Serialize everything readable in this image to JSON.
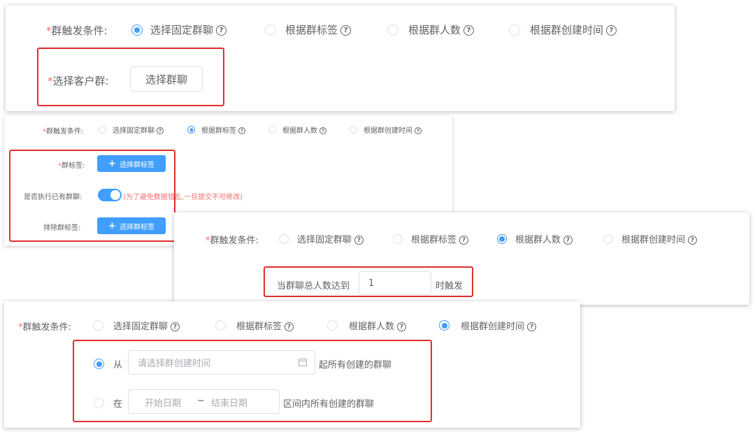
{
  "trigger_label": "群触发条件:",
  "required_mark": "*",
  "help_glyph": "?",
  "options": {
    "fixed": "选择固定群聊",
    "by_tag": "根据群标签",
    "by_count": "根据群人数",
    "by_time": "根据群创建时间"
  },
  "panel1": {
    "selected": "fixed",
    "customer_group_label": "选择客户群:",
    "select_group_button": "选择群聊"
  },
  "panel2": {
    "selected": "by_tag",
    "group_tag_label": "群标签:",
    "select_tag_button": "选择群标签",
    "plus": "+",
    "apply_existing_label": "是否执行已有群聊:",
    "apply_existing_on": true,
    "apply_existing_hint": "(为了避免数据错乱,一旦提交不可修改)",
    "exclude_tag_label": "排除群标签:"
  },
  "panel3": {
    "selected": "by_count",
    "prefix": "当群聊总人数达到",
    "count_value": "1",
    "suffix": "时触发"
  },
  "panel4": {
    "selected": "by_time",
    "from_option_label": "从",
    "from_placeholder": "请选择群创建时间",
    "from_suffix": "起所有创建的群聊",
    "range_option_label": "在",
    "start_placeholder": "开始日期",
    "range_separator": "~",
    "end_placeholder": "结束日期",
    "range_suffix": "区间内所有创建的群聊"
  },
  "colors": {
    "primary": "#409eff",
    "danger": "#f56c6c",
    "highlight_box": "#e02d2d"
  }
}
